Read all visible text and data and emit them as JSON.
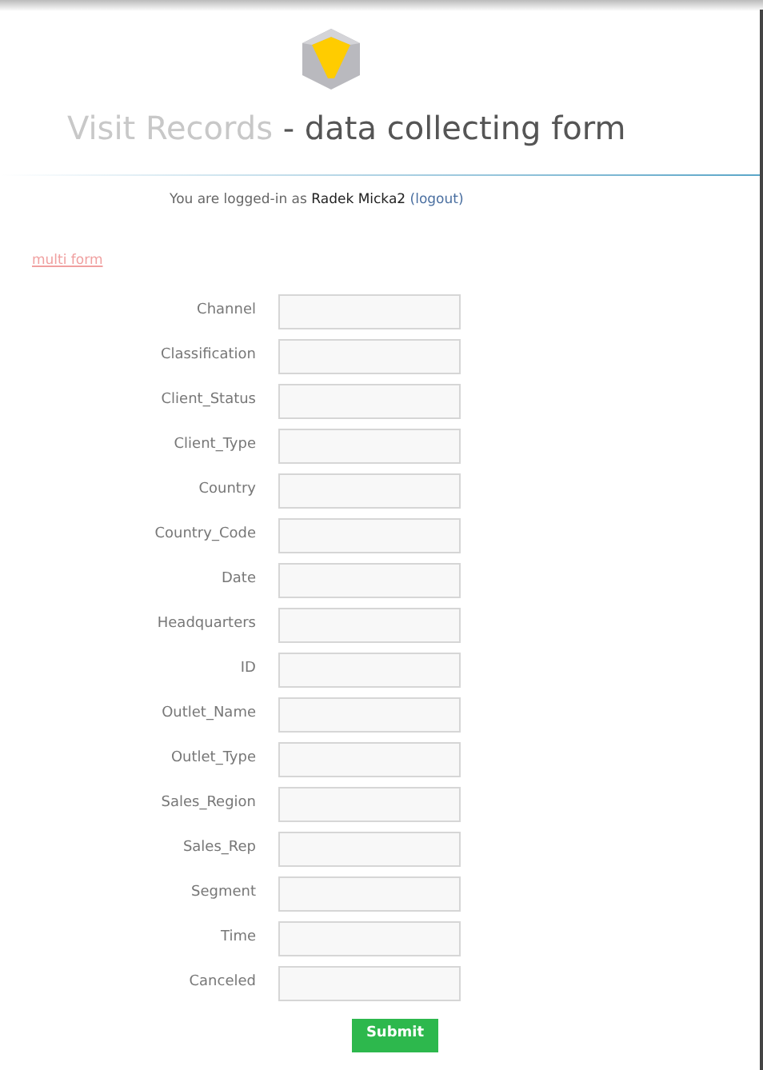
{
  "header": {
    "title_faded": "Visit Records",
    "title_rest": "- data collecting form"
  },
  "login": {
    "text": "You are logged-in as **Radek Micka2**",
    "logout": "(logout)"
  },
  "multi_form_link": "multi form",
  "fields": [
    {
      "label": "Channel"
    },
    {
      "label": "Classification"
    },
    {
      "label": "Client_Status"
    },
    {
      "label": "Client_Type"
    },
    {
      "label": "Country"
    },
    {
      "label": "Country_Code"
    },
    {
      "label": "Date"
    },
    {
      "label": "Headquarters"
    },
    {
      "label": "ID"
    },
    {
      "label": "Outlet_Name"
    },
    {
      "label": "Outlet_Type"
    },
    {
      "label": "Sales_Region"
    },
    {
      "label": "Sales_Rep"
    },
    {
      "label": "Segment"
    },
    {
      "label": "Time"
    },
    {
      "label": "Canceled"
    }
  ],
  "submit": "Submit"
}
